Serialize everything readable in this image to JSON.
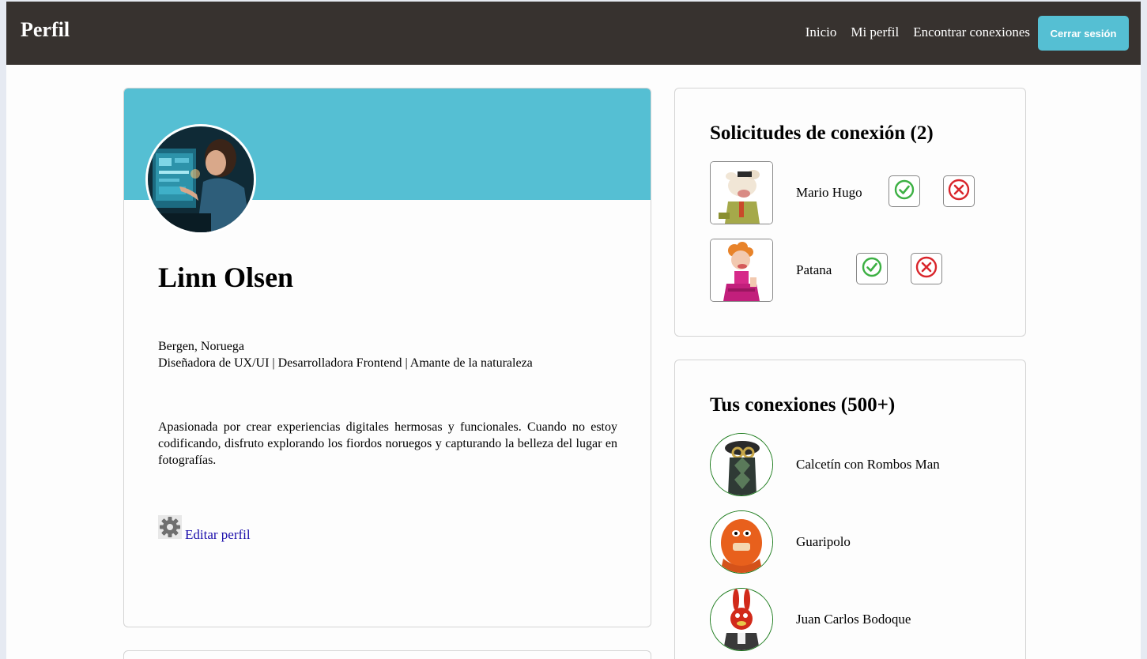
{
  "navbar": {
    "brand": "Perfil",
    "links": [
      "Inicio",
      "Mi perfil",
      "Encontrar conexiones"
    ],
    "logout_label": "Cerrar sesión"
  },
  "profile": {
    "name": "Linn Olsen",
    "location": "Bergen, Noruega",
    "headline": "Diseñadora de UX/UI | Desarrolladora Frontend | Amante de la naturaleza",
    "bio": "Apasionada por crear experiencias digitales hermosas y funcionales. Cuando no estoy codificando, disfruto explorando los fiordos noruegos y capturando la belleza del lugar en fotografías.",
    "edit_label": "Editar perfil"
  },
  "requests": {
    "title": "Solicitudes de conexión (2)",
    "items": [
      {
        "name": "Mario Hugo"
      },
      {
        "name": "Patana"
      }
    ]
  },
  "connections": {
    "title": "Tus conexiones (500+)",
    "items": [
      {
        "name": "Calcetín con Rombos Man"
      },
      {
        "name": "Guaripolo"
      },
      {
        "name": "Juan Carlos Bodoque"
      }
    ]
  },
  "colors": {
    "navbar": "#37322f",
    "accent": "#55bfd3",
    "accept": "#3cb043",
    "reject": "#d9262c"
  }
}
